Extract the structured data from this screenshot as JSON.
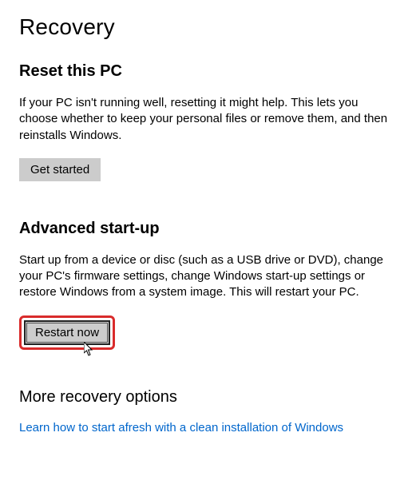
{
  "page": {
    "title": "Recovery"
  },
  "reset": {
    "heading": "Reset this PC",
    "text": "If your PC isn't running well, resetting it might help. This lets you choose whether to keep your personal files or remove them, and then reinstalls Windows.",
    "button": "Get started"
  },
  "advanced": {
    "heading": "Advanced start-up",
    "text": "Start up from a device or disc (such as a USB drive or DVD), change your PC's firmware settings, change Windows start-up settings or restore Windows from a system image. This will restart your PC.",
    "button": "Restart now"
  },
  "more": {
    "heading": "More recovery options",
    "link": "Learn how to start afresh with a clean installation of Windows"
  }
}
